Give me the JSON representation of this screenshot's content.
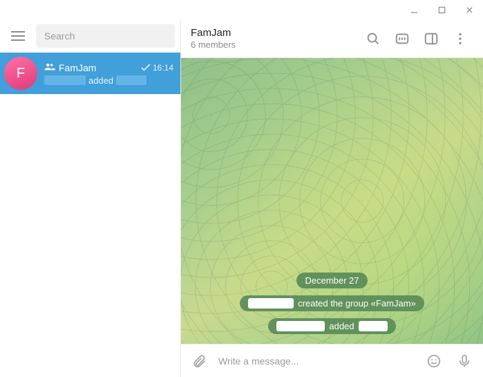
{
  "window_controls": {
    "minimize": "minimize",
    "maximize": "maximize",
    "close": "close"
  },
  "sidebar": {
    "search_placeholder": "Search",
    "chat": {
      "avatar_letter": "F",
      "name": "FamJam",
      "time": "16:14",
      "preview_mid": "added"
    }
  },
  "header": {
    "title": "FamJam",
    "subtitle": "6 members"
  },
  "messages": {
    "date_label": "December 27",
    "created_text": "created the group «FamJam»",
    "added_text": "added"
  },
  "composer": {
    "placeholder": "Write a message..."
  }
}
